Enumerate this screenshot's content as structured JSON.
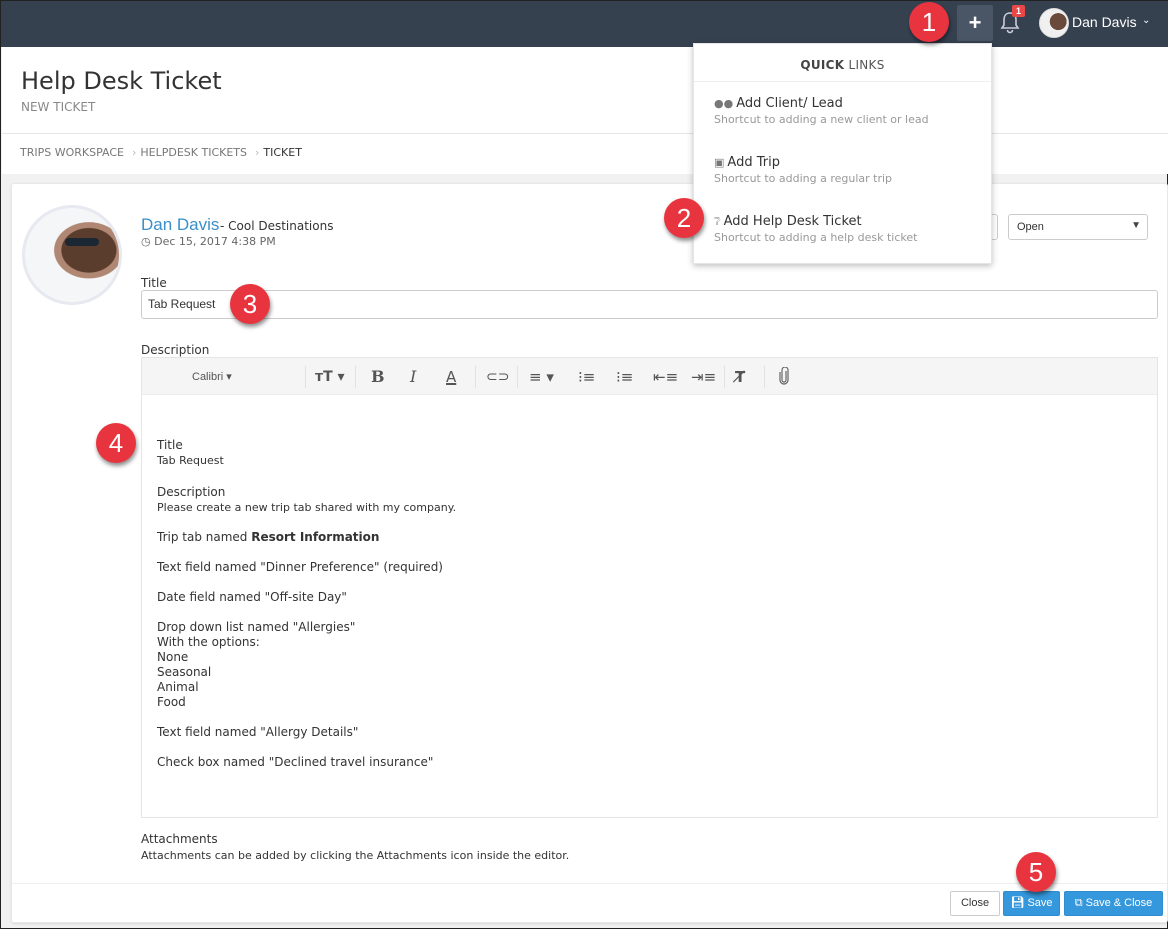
{
  "topbar": {
    "add_icon": "plus-icon",
    "notifications_icon": "bell-icon",
    "notifications_count": "1",
    "user_name": "Dan Davis",
    "user_caret": "⌄"
  },
  "page": {
    "title": "Help Desk Ticket",
    "subtitle": "NEW TICKET"
  },
  "breadcrumb": [
    "TRIPS WORKSPACE",
    "HELPDESK TICKETS",
    "TICKET"
  ],
  "ticket": {
    "author_name": "Dan Davis",
    "author_company": "- Cool Destinations",
    "timestamp": "Dec 15, 2017 4:38 PM",
    "status_value": "Open",
    "title_label": "Title",
    "title_value": "Tab Request",
    "description_label": "Description",
    "attachments_label": "Attachments",
    "attachments_help": "Attachments can be added by clicking the Attachments icon inside the editor."
  },
  "editor": {
    "font_name": "Calibri",
    "toolbar_icons": [
      "font-size-icon",
      "bold-icon",
      "italic-icon",
      "font-color-icon",
      "link-icon",
      "align-icon",
      "ordered-list-icon",
      "unordered-list-icon",
      "outdent-icon",
      "indent-icon",
      "clear-format-icon",
      "attachment-icon"
    ],
    "content": {
      "h1": "Title",
      "v1": "Tab Request",
      "h2": "Description",
      "v2": "Please create a new trip tab shared with my company.",
      "line_tab_prefix": "Trip tab named ",
      "line_tab_bold": "Resort Information",
      "line_text1": "Text field named \"Dinner Preference\" (required)",
      "line_date": "Date field named \"Off-site Day\"",
      "line_dropdown": "Drop down list named \"Allergies\"",
      "line_options": "With the options:",
      "options": [
        "None",
        "Seasonal",
        "Animal",
        "Food"
      ],
      "line_text2": "Text field named \"Allergy Details\"",
      "line_checkbox": "Check box named \"Declined travel insurance\""
    }
  },
  "buttons": {
    "close": "Close",
    "save": "Save",
    "save_close": "Save & Close"
  },
  "quick_links": {
    "header_bold": "QUICK",
    "header_rest": " LINKS",
    "items": [
      {
        "icon": "users-icon",
        "title": "Add Client/ Lead",
        "subtitle": "Shortcut to adding a new client or lead"
      },
      {
        "icon": "truck-icon",
        "title": "Add Trip",
        "subtitle": "Shortcut to adding a regular trip"
      },
      {
        "icon": "question-circle-icon",
        "title": "Add Help Desk Ticket",
        "subtitle": "Shortcut to adding a help desk ticket"
      }
    ]
  },
  "callouts": [
    "1",
    "2",
    "3",
    "4",
    "5"
  ],
  "colors": {
    "topbar": "#364150",
    "accent_blue": "#3598dc",
    "callout_red": "#e8343f",
    "link_blue": "#3a8fc9"
  }
}
